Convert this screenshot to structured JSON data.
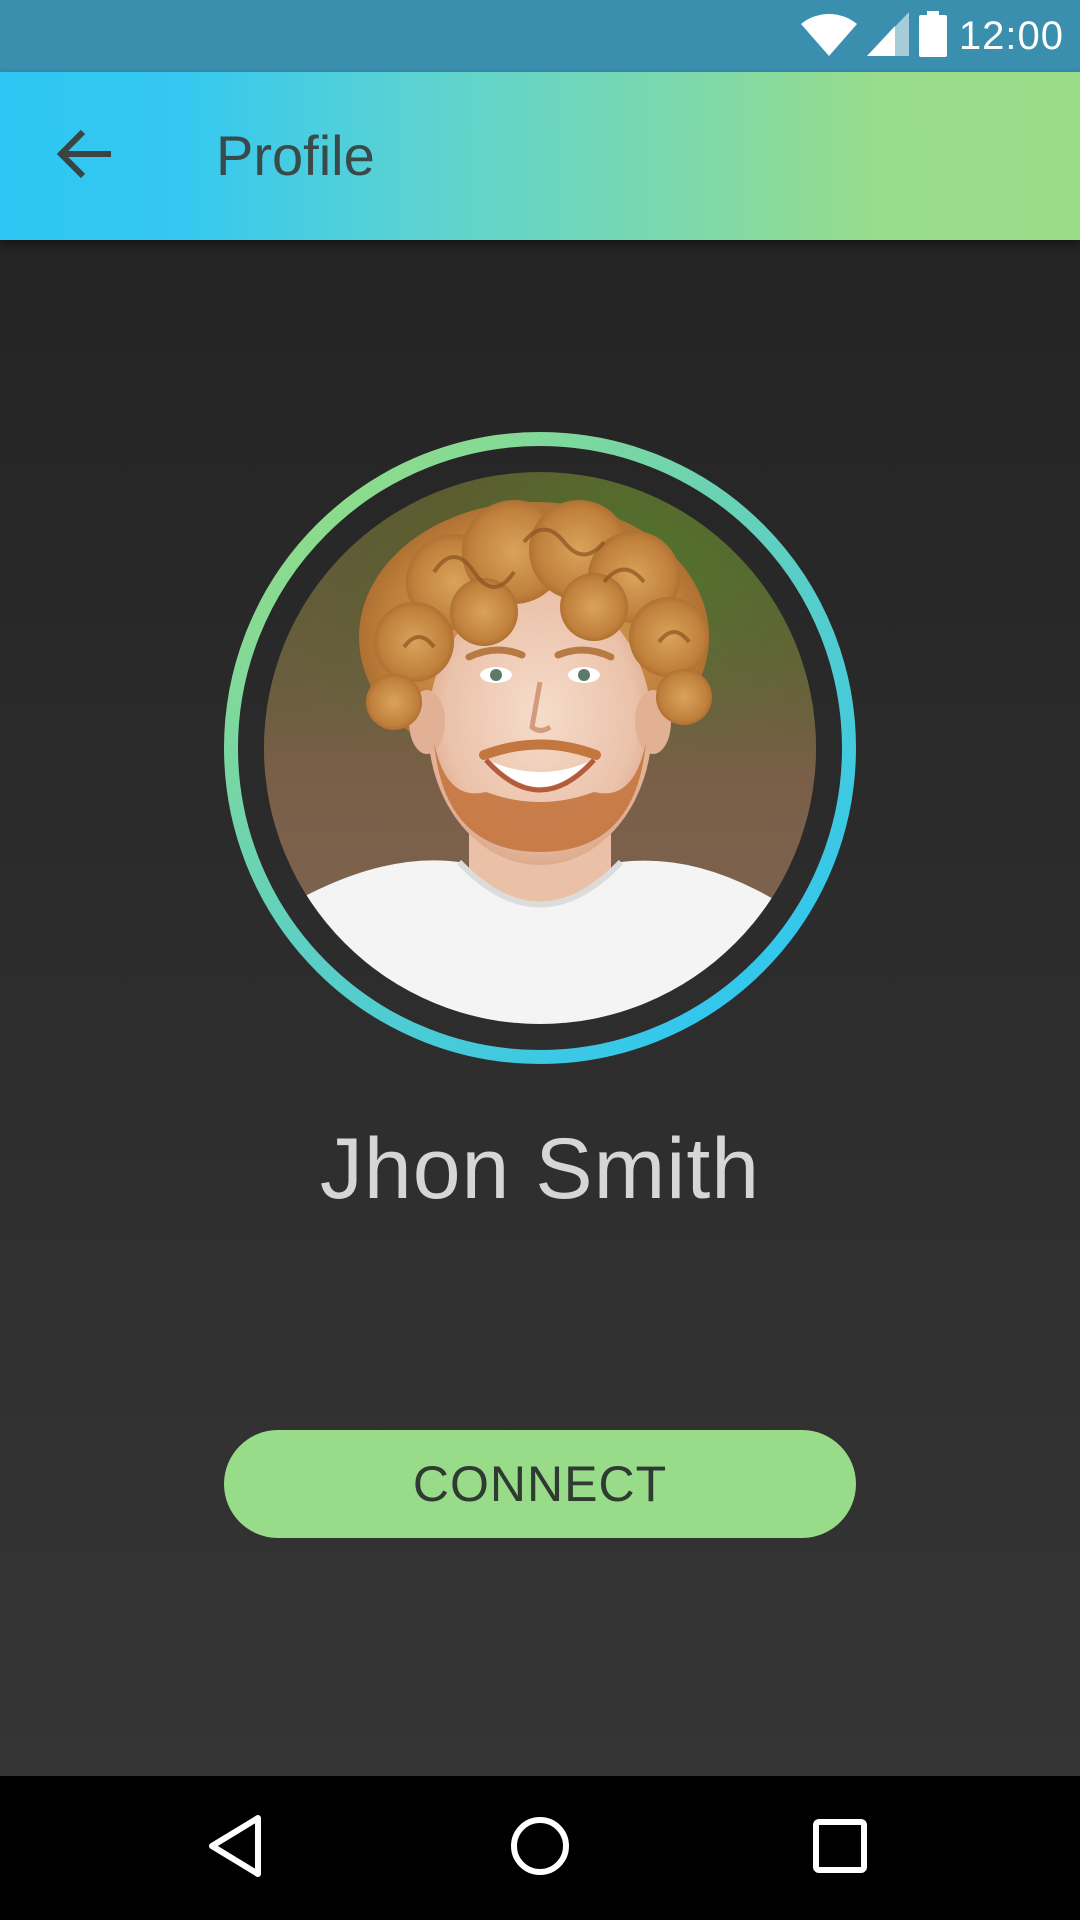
{
  "status_bar": {
    "time": "12:00",
    "icons": [
      "wifi-icon",
      "cell-signal-icon",
      "battery-icon"
    ]
  },
  "app_bar": {
    "title": "Profile",
    "back_icon": "arrow-left-icon"
  },
  "profile": {
    "name": "Jhon Smith",
    "avatar": "profile-photo"
  },
  "actions": {
    "connect_label": "CONNECT"
  },
  "nav_bar": {
    "buttons": [
      "back-triangle-icon",
      "home-circle-icon",
      "recents-square-icon"
    ]
  },
  "colors": {
    "status_bar": "#3a8fae",
    "app_bar_start": "#2ec6f2",
    "app_bar_end": "#9bdc88",
    "ring_start": "#8edc8a",
    "ring_end": "#2ec6f2",
    "button": "#98db88",
    "background": "#2b2b2b",
    "name_text": "#d6d6d6"
  }
}
